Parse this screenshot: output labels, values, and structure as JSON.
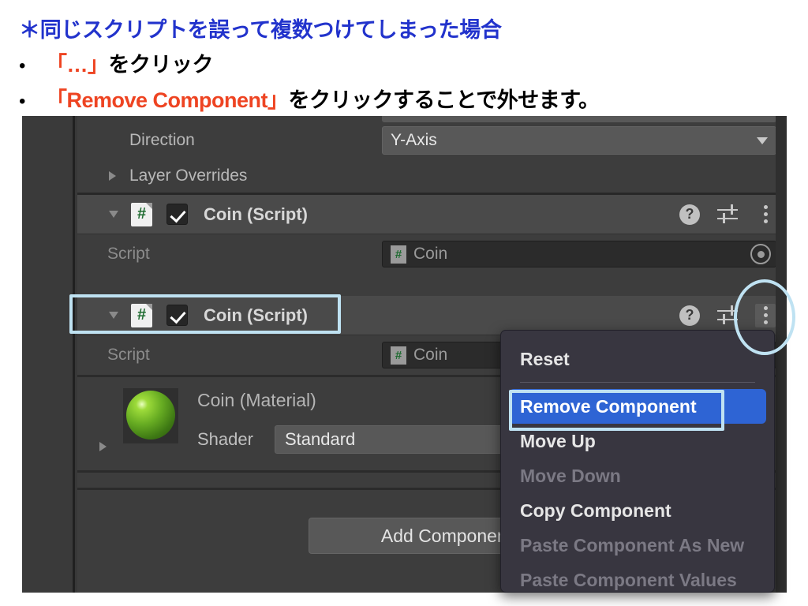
{
  "slide": {
    "title": "＊同じスクリプトを誤って複数つけてしまった場合",
    "bullets": [
      {
        "dot": "•",
        "accent": "「…」",
        "plain": " をクリック"
      },
      {
        "dot": "•",
        "accent": "「Remove Component」",
        "plain": " をクリックすることで外せます。"
      }
    ],
    "colors": {
      "title": "#2233cc",
      "accent": "#ee4422",
      "plain": "#000000"
    }
  },
  "inspector": {
    "rows": {
      "direction": {
        "label": "Direction",
        "value": "Y-Axis"
      },
      "layer_overrides": {
        "label": "Layer Overrides"
      }
    },
    "components": [
      {
        "title": "Coin (Script)",
        "icon": "csharp-script-icon",
        "glyph": "#",
        "enabled": true,
        "script_label": "Script",
        "script_value": "Coin",
        "help_icon": "?",
        "icons": [
          "help-icon",
          "preset-icon",
          "kebab-menu-icon"
        ]
      },
      {
        "title": "Coin (Script)",
        "icon": "csharp-script-icon",
        "glyph": "#",
        "enabled": true,
        "script_label": "Script",
        "script_value": "Coin",
        "help_icon": "?",
        "icons": [
          "help-icon",
          "preset-icon",
          "kebab-menu-icon"
        ]
      }
    ],
    "material": {
      "name": "Coin (Material)",
      "shader_label": "Shader",
      "shader_value": "Standard",
      "preview_color": "#66ab22"
    },
    "add_component_label": "Add Component"
  },
  "context_menu": {
    "items": [
      {
        "label": "Reset",
        "state": "normal"
      },
      {
        "label": "Remove Component",
        "state": "selected"
      },
      {
        "label": "Move Up",
        "state": "normal"
      },
      {
        "label": "Move Down",
        "state": "disabled"
      },
      {
        "label": "Copy Component",
        "state": "normal"
      },
      {
        "label": "Paste Component As New",
        "state": "disabled"
      },
      {
        "label": "Paste Component Values",
        "state": "disabled"
      }
    ],
    "selected_color": "#2e64d4"
  },
  "annotations": {
    "color": "#bfe2f2",
    "shapes": [
      {
        "kind": "rectangle",
        "target": "second-coin-script-header"
      },
      {
        "kind": "rectangle",
        "target": "remove-component-menu-item"
      },
      {
        "kind": "ellipse",
        "target": "kebab-menu-icon"
      }
    ]
  }
}
